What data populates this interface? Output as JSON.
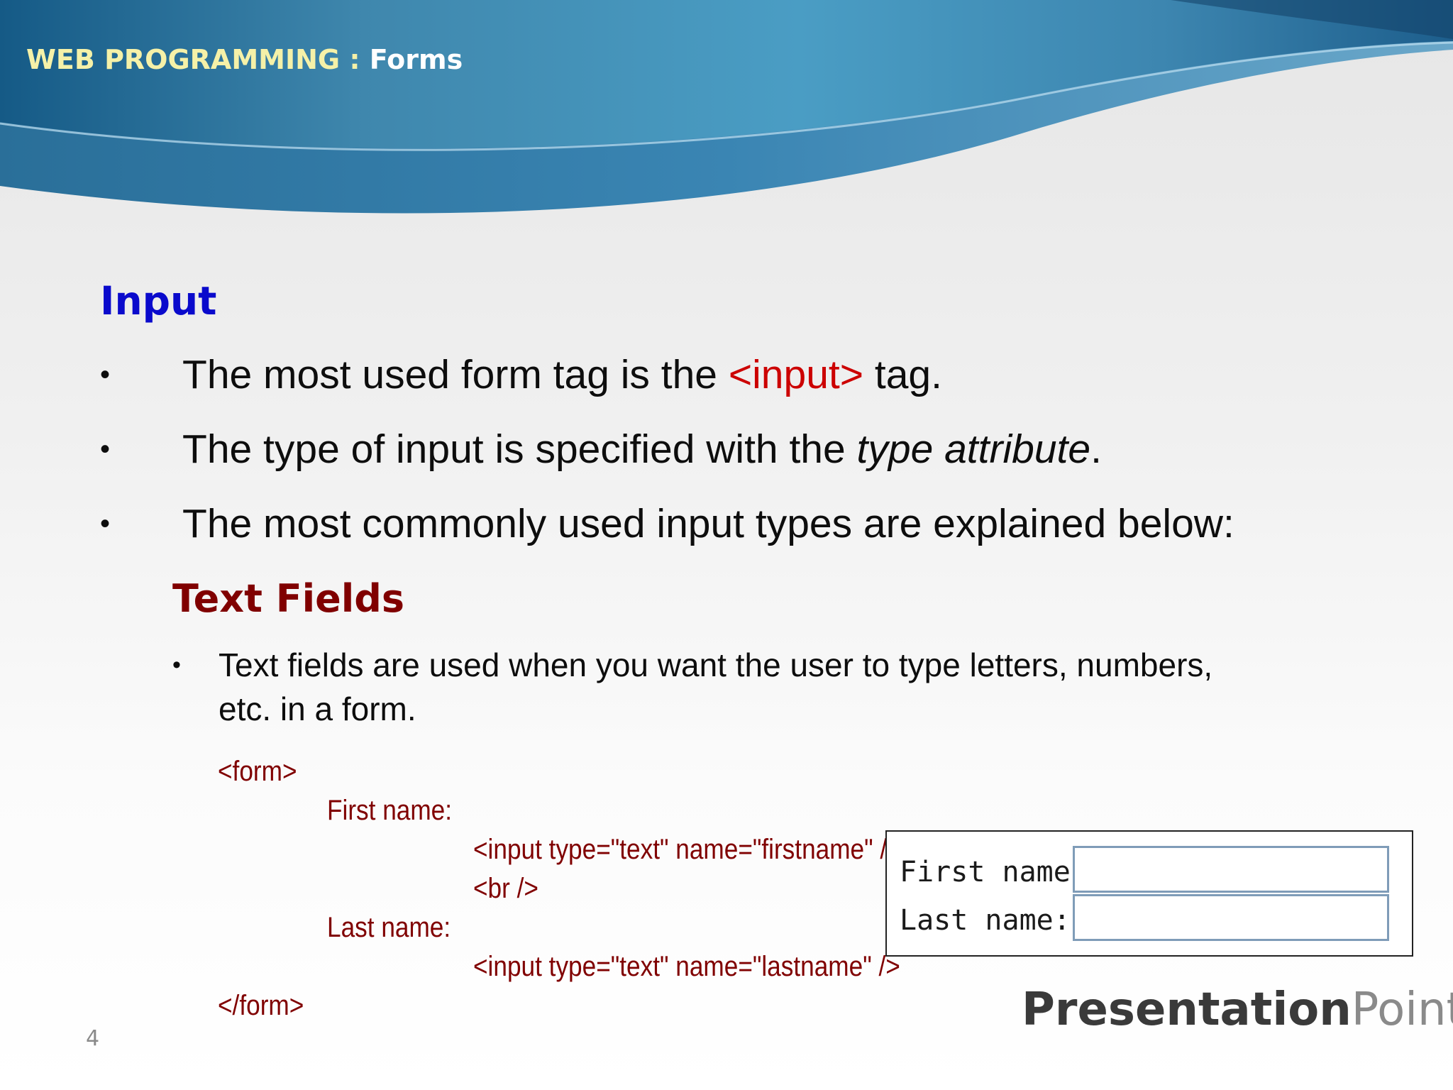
{
  "header": {
    "course": "WEB PROGRAMMING",
    "separator": " : ",
    "topic": "Forms"
  },
  "section_title": "Input",
  "bullets": [
    {
      "before": "The most used form tag is the ",
      "highlight": "<input>",
      "after": " tag."
    },
    {
      "before": "The type of input is specified with the ",
      "italic": "type attribute",
      "after": "."
    },
    {
      "text": "The most commonly used input types are explained below:"
    }
  ],
  "subsection_title": "Text Fields",
  "sub_bullet": {
    "line1": "Text fields are used when you want the user to type letters, numbers,",
    "line2": "etc. in a form."
  },
  "code": {
    "form_open": "<form>",
    "first_label": "First name:",
    "input_first": "<input type=\"text\" name=\"firstname\" />",
    "br": "<br />",
    "last_label": "Last name:",
    "input_last": "<input type=\"text\" name=\"lastname\" />",
    "form_close": "</form>"
  },
  "demo": {
    "first_label": "First name:",
    "first_value": "",
    "last_label": "Last name:",
    "last_value": ""
  },
  "logo": {
    "part1": "Presentation",
    "part2": "Point"
  },
  "page_number": "4",
  "colors": {
    "heading_blue": "#0a0acc",
    "code_red": "#800000",
    "tag_red": "#cc0000",
    "banner_blue": "#2f7fa8"
  }
}
